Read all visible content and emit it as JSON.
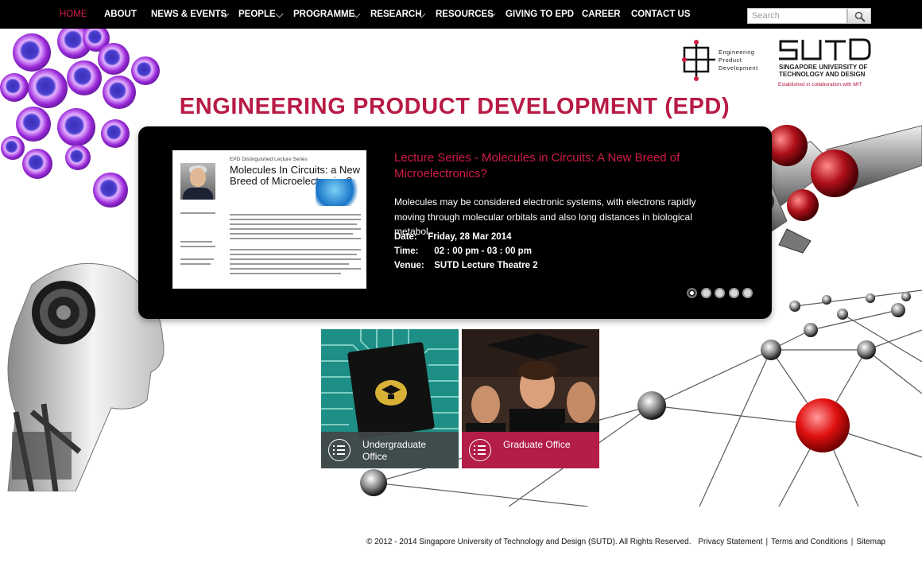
{
  "nav": {
    "items": [
      {
        "label": "HOME",
        "active": true,
        "has_dropdown": false
      },
      {
        "label": "ABOUT",
        "active": false,
        "has_dropdown": false
      },
      {
        "label": "NEWS & EVENTS",
        "active": false,
        "has_dropdown": true
      },
      {
        "label": "PEOPLE",
        "active": false,
        "has_dropdown": true
      },
      {
        "label": "PROGRAMME",
        "active": false,
        "has_dropdown": true
      },
      {
        "label": "RESEARCH",
        "active": false,
        "has_dropdown": true
      },
      {
        "label": "RESOURCES",
        "active": false,
        "has_dropdown": true
      },
      {
        "label": "GIVING TO EPD",
        "active": false,
        "has_dropdown": false
      },
      {
        "label": "CAREER",
        "active": false,
        "has_dropdown": false
      },
      {
        "label": "CONTACT US",
        "active": false,
        "has_dropdown": false
      }
    ],
    "search_placeholder": "Search",
    "search_icon": "magnifier-icon"
  },
  "logos": {
    "epd": {
      "line1": "Engineering",
      "line2": "Product",
      "line3": "Development"
    },
    "sutd": {
      "mark": "SUTD",
      "line1": "SINGAPORE UNIVERSITY OF",
      "line2": "TECHNOLOGY AND DESIGN",
      "collab": "Established in collaboration with MIT"
    }
  },
  "page_title": "ENGINEERING PRODUCT DEVELOPMENT (EPD)",
  "slider": {
    "poster": {
      "series": "EPD Distinguished Lecture Series",
      "title": "Molecules In Circuits: a New Breed of Microelectronics?"
    },
    "title": "Lecture Series - Molecules in Circuits: A New Breed of Microelectronics?",
    "description": "Molecules may be considered electronic systems, with electrons rapidly moving through molecular orbitals and also long distances in biological metabol...",
    "date_label": "Date:",
    "date_value": "Friday, 28 Mar 2014",
    "time_label": "Time:",
    "time_value": "02 : 00 pm - 03 : 00 pm",
    "venue_label": "Venue:",
    "venue_value": "SUTD Lecture Theatre 2",
    "slide_count": 5,
    "active_slide": 1
  },
  "tiles": {
    "undergraduate": {
      "label": "Undergraduate Office",
      "icon": "list-icon"
    },
    "graduate": {
      "label": "Graduate Office",
      "icon": "list-icon"
    }
  },
  "footer": {
    "copyright": "© 2012 - 2014 Singapore University of Technology and Design (SUTD). All Rights Reserved.",
    "links": [
      "Privacy Statement",
      "Terms and Conditions",
      "Sitemap"
    ]
  },
  "colors": {
    "accent": "#b81b45",
    "nav_bg": "#000000",
    "slider_bg": "#000000",
    "graduate_tile": "#b31d48",
    "undergraduate_tile": "#424646"
  }
}
